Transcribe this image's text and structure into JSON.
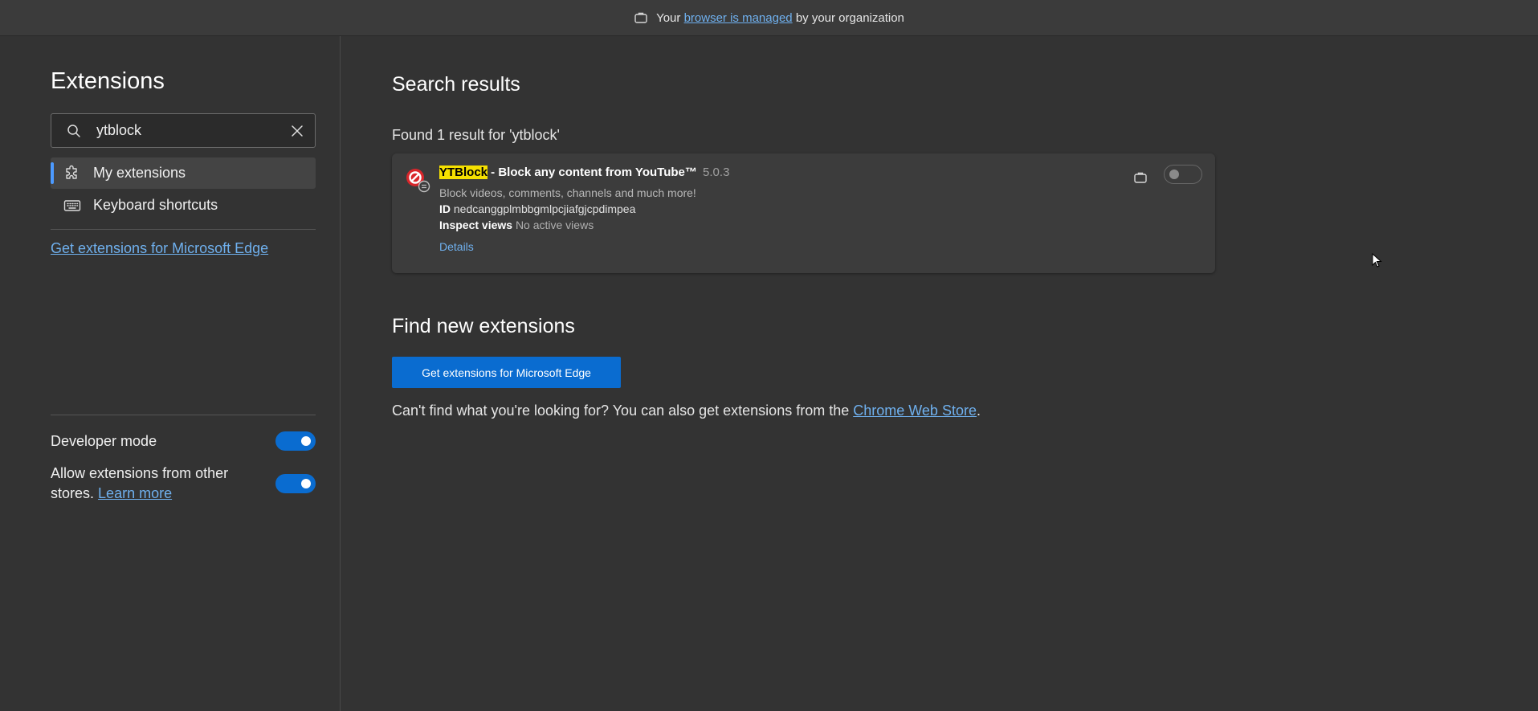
{
  "banner": {
    "prefix": "Your ",
    "link": "browser is managed",
    "suffix": " by your organization",
    "icon": "briefcase-icon"
  },
  "sidebar": {
    "title": "Extensions",
    "search": {
      "value": "ytblock",
      "search_icon": "search-icon",
      "clear_icon": "close-icon"
    },
    "nav": [
      {
        "label": "My extensions",
        "icon": "puzzle-icon",
        "active": true
      },
      {
        "label": "Keyboard shortcuts",
        "icon": "keyboard-icon",
        "active": false
      }
    ],
    "get_link": "Get extensions for Microsoft Edge",
    "developer_mode": {
      "label": "Developer mode",
      "enabled": true
    },
    "allow_other_stores": {
      "label": "Allow extensions from other stores.",
      "link": "Learn more",
      "enabled": true
    }
  },
  "main": {
    "search_results_title": "Search results",
    "found_text": "Found 1 result for 'ytblock'",
    "extension": {
      "name_highlight": "YTBlock",
      "name_rest": " - Block any content from YouTube™",
      "version": "5.0.3",
      "description": "Block videos, comments, channels and much more!",
      "id_label": "ID",
      "id_value": "nedcanggplmbbgmlpcjiafgjcpdimpea",
      "inspect_label": "Inspect views",
      "inspect_value": "No active views",
      "details_label": "Details",
      "enabled": false
    },
    "find_title": "Find new extensions",
    "cta_label": "Get extensions for Microsoft Edge",
    "help_prefix": "Can't find what you're looking for? You can also get extensions from the ",
    "help_link": "Chrome Web Store",
    "help_suffix": "."
  },
  "colors": {
    "accent": "#0a6cd0",
    "link": "#6fb0ee",
    "highlight": "#f5e000",
    "background": "#333333"
  }
}
